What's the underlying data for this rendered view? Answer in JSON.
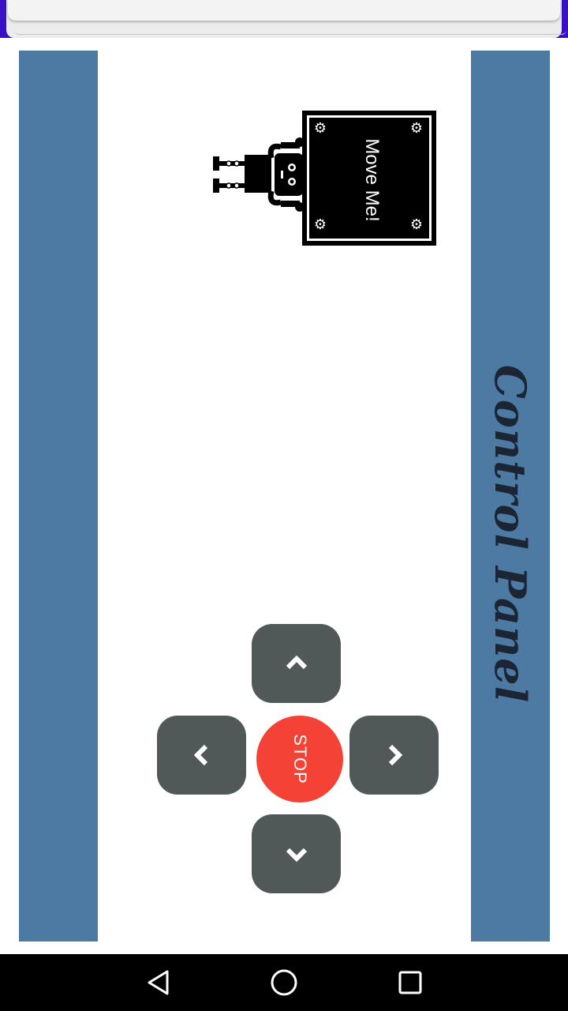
{
  "sign": {
    "label": "Move Me!"
  },
  "panel": {
    "title": "Control Panel"
  },
  "controls": {
    "up_icon": "chevron-up-icon",
    "down_icon": "chevron-down-icon",
    "left_icon": "chevron-left-icon",
    "right_icon": "chevron-right-icon",
    "stop_label": "STOP"
  },
  "nav": {
    "back_icon": "back-triangle-icon",
    "home_icon": "home-circle-icon",
    "recents_icon": "recents-square-icon"
  },
  "colors": {
    "side_panels": "#4d7aa3",
    "control_button": "#505858",
    "stop_button": "#f44336",
    "status_bar": "#3a10c4"
  }
}
